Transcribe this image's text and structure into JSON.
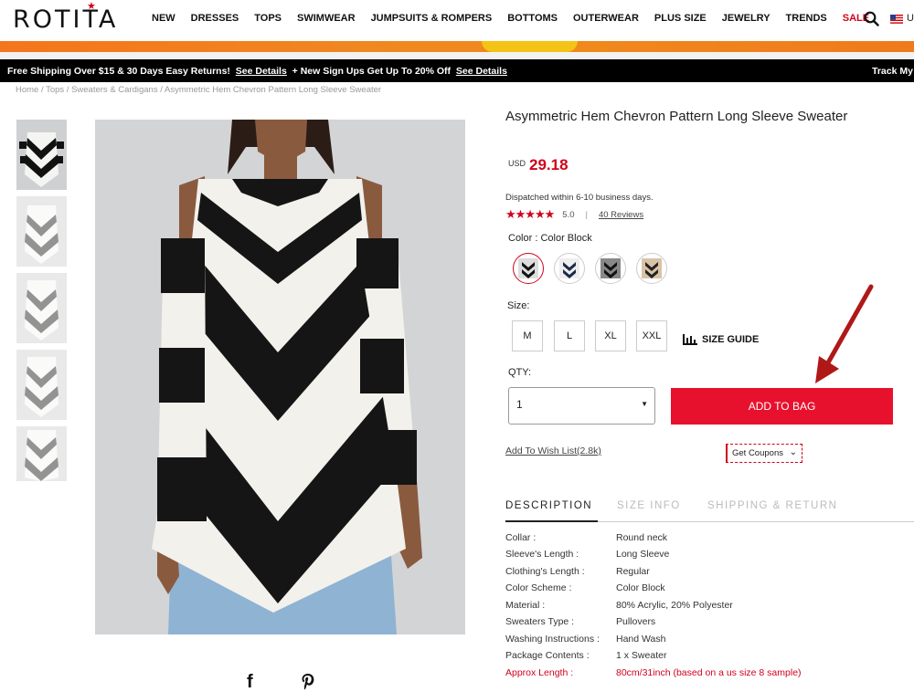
{
  "brand": "ROTITA",
  "nav": [
    "NEW",
    "DRESSES",
    "TOPS",
    "SWIMWEAR",
    "JUMPSUITS & ROMPERS",
    "BOTTOMS",
    "OUTERWEAR",
    "PLUS SIZE",
    "JEWELRY",
    "TRENDS",
    "SALE"
  ],
  "lang_partial": "U",
  "promo": {
    "text1": "Free Shipping Over $15 & 30 Days Easy Returns!",
    "link1": "See Details",
    "text2": "+ New Sign Ups Get Up To 20% Off",
    "link2": "See Details",
    "right": "Track My"
  },
  "breadcrumb": "Home / Tops / Sweaters & Cardigans / Asymmetric Hem Chevron Pattern Long Sleeve Sweater",
  "product": {
    "title": "Asymmetric Hem Chevron Pattern Long Sleeve Sweater",
    "currency": "USD",
    "price": "29.18",
    "dispatch": "Dispatched within 6-10 business days.",
    "stars": "★★★★★",
    "rating": "5.0",
    "rating_sep": "|",
    "reviews": "40 Reviews",
    "color_label": "Color : Color Block",
    "size_label": "Size:",
    "sizes": [
      "M",
      "L",
      "XL",
      "XXL"
    ],
    "size_guide": "SIZE GUIDE",
    "qty_label": "QTY:",
    "qty_value": "1",
    "add_to_bag": "ADD TO BAG",
    "wishlist": "Add To Wish List(2.8k)",
    "coupons": "Get Coupons"
  },
  "tabs": [
    "DESCRIPTION",
    "SIZE INFO",
    "SHIPPING & RETURN"
  ],
  "specs": [
    {
      "k": "Collar :",
      "v": "Round neck"
    },
    {
      "k": "Sleeve's Length :",
      "v": "Long Sleeve"
    },
    {
      "k": "Clothing's Length :",
      "v": "Regular"
    },
    {
      "k": "Color Scheme :",
      "v": "Color Block"
    },
    {
      "k": "Material :",
      "v": "80% Acrylic, 20% Polyester"
    },
    {
      "k": "Sweaters Type :",
      "v": "Pullovers"
    },
    {
      "k": "Washing Instructions :",
      "v": "Hand Wash"
    },
    {
      "k": "Package Contents :",
      "v": "1 x Sweater"
    },
    {
      "k": "Approx Length :",
      "v": "80cm/31inch (based on a us size 8 sample)"
    }
  ],
  "icons": {
    "search": "search-icon",
    "facebook": "facebook-icon",
    "pinterest": "pinterest-icon",
    "size_guide": "bar-chart-icon",
    "arrow": "red-arrow-annotation"
  },
  "colors": {
    "accent": "#e8112d",
    "price": "#d0021b",
    "promo_bg": "#000000"
  }
}
